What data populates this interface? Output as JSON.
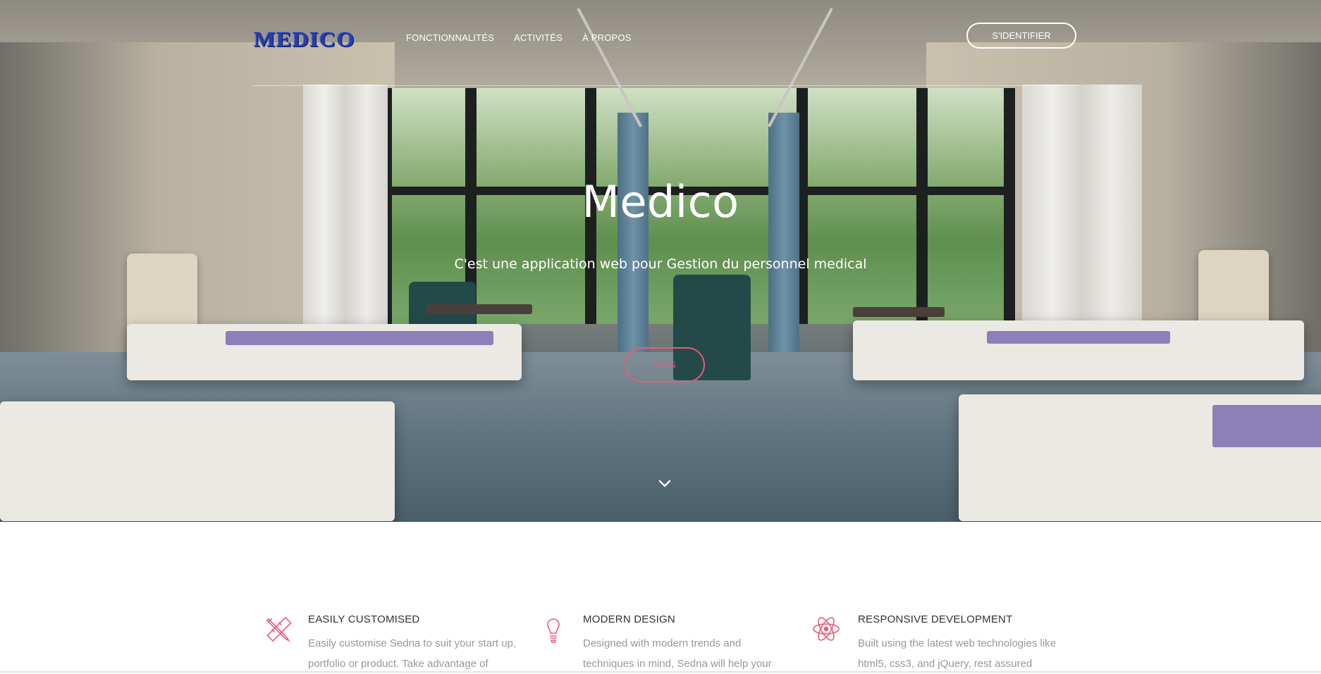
{
  "nav": {
    "logo": "MEDICO",
    "items": [
      {
        "label": "FONCTIONNALITÉS"
      },
      {
        "label": "ACTIVITÉS"
      },
      {
        "label": "À PROPOS"
      }
    ],
    "login_label": "S'IDENTIFIER"
  },
  "hero": {
    "title": "Medico",
    "subtitle": "C'est une application web pour Gestion du personnel medical",
    "cta_label": "PLUS"
  },
  "features": [
    {
      "icon": "pencil-ruler-icon",
      "title": "EASILY CUSTOMISED",
      "text": "Easily customise Sedna to suit your start up, portfolio or product. Take advantage of"
    },
    {
      "icon": "lightbulb-icon",
      "title": "MODERN DESIGN",
      "text": "Designed with modern trends and techniques in mind, Sedna will help your"
    },
    {
      "icon": "atom-icon",
      "title": "RESPONSIVE DEVELOPMENT",
      "text": "Built using the latest web technologies like html5, css3, and jQuery, rest assured"
    }
  ],
  "colors": {
    "accent": "#ea5a7a",
    "logo": "#2a3ea8",
    "feature_text": "#999999",
    "feature_title": "#333333"
  }
}
